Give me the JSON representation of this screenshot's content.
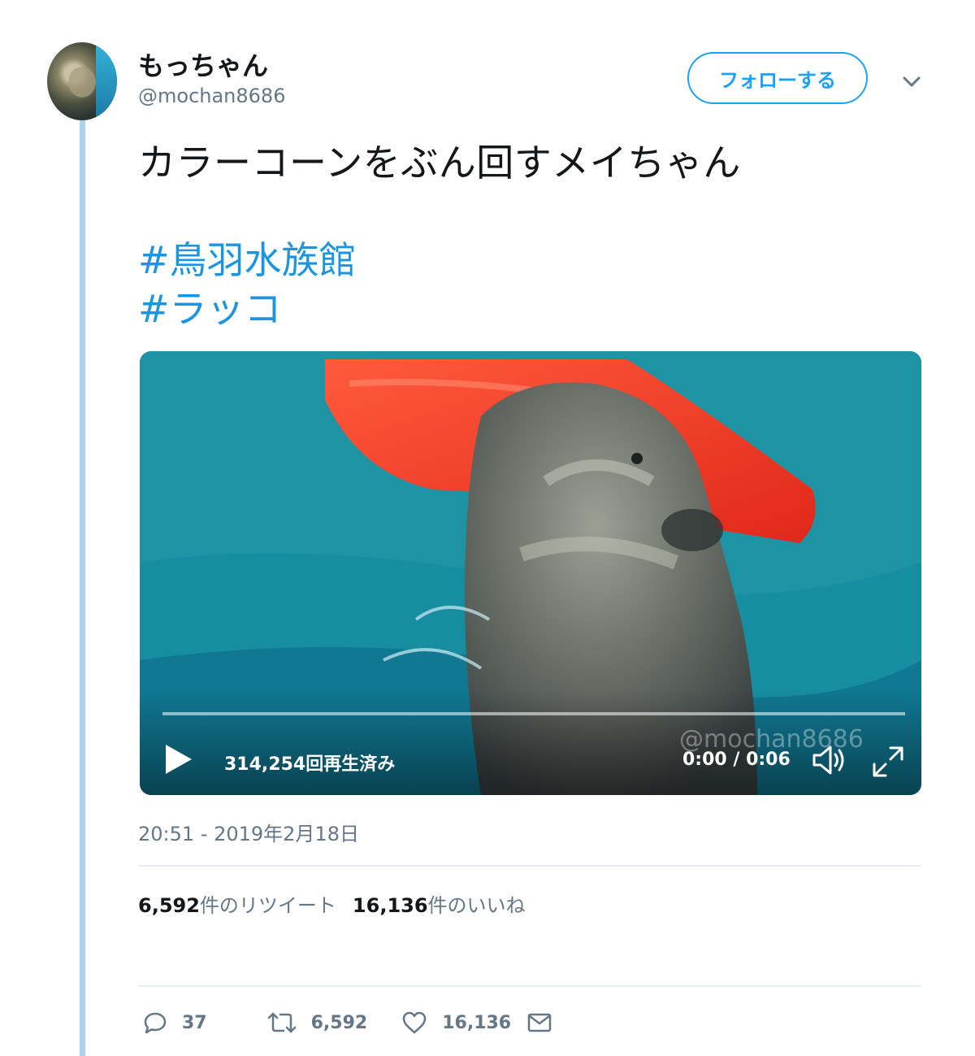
{
  "user": {
    "display_name": "もっちゃん",
    "handle": "@mochan8686",
    "follow_label": "フォローする"
  },
  "tweet": {
    "text": "カラーコーンをぶん回すメイちゃん",
    "hashtags": [
      "#鳥羽水族館",
      "#ラッコ"
    ],
    "timestamp": "20:51 - 2019年2月18日"
  },
  "video": {
    "views": "314,254回再生済み",
    "time": "0:00 / 0:06",
    "watermark": "@mochan8686",
    "progress": 0
  },
  "stats": {
    "retweets_count": "6,592",
    "retweets_label": "件のリツイート",
    "likes_count": "16,136",
    "likes_label": "件のいいね"
  },
  "actions": {
    "reply": "37",
    "retweet": "6,592",
    "like": "16,136"
  },
  "icons": [
    "chevron-down-icon",
    "play-icon",
    "volume-icon",
    "fullscreen-icon",
    "reply-icon",
    "retweet-icon",
    "like-icon",
    "message-icon"
  ],
  "colors": {
    "accent": "#1da1f2",
    "hashtag": "#1b95e0",
    "thread_line": "#a9d4ec",
    "muted": "#657786"
  }
}
